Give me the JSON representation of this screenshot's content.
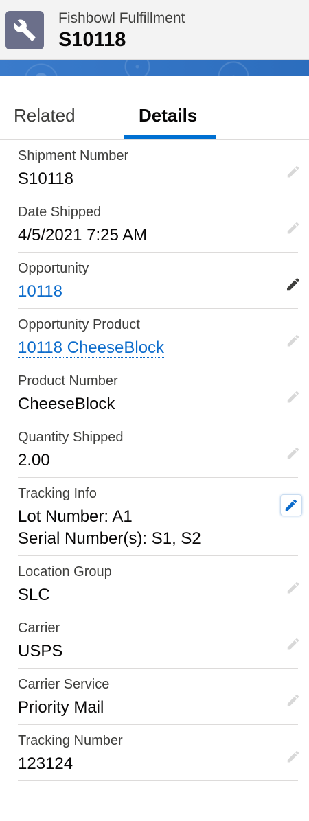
{
  "header": {
    "object_type": "Fishbowl Fulfillment",
    "record_name": "S10118",
    "icon": "wrench-icon"
  },
  "tabs": [
    {
      "label": "Related",
      "active": false
    },
    {
      "label": "Details",
      "active": true
    }
  ],
  "fields": [
    {
      "label": "Shipment Number",
      "value": "S10118"
    },
    {
      "label": "Date Shipped",
      "value": "4/5/2021 7:25 AM"
    },
    {
      "label": "Opportunity",
      "value": "10118"
    },
    {
      "label": "Opportunity Product",
      "value": "10118 CheeseBlock"
    },
    {
      "label": "Product Number",
      "value": "CheeseBlock"
    },
    {
      "label": "Quantity Shipped",
      "value": "2.00"
    },
    {
      "label": "Tracking Info",
      "value_line1": "Lot Number: A1",
      "value_line2": "Serial Number(s): S1, S2"
    },
    {
      "label": "Location Group",
      "value": "SLC"
    },
    {
      "label": "Carrier",
      "value": "USPS"
    },
    {
      "label": "Carrier Service",
      "value": "Priority Mail"
    },
    {
      "label": "Tracking Number",
      "value": "123124"
    }
  ],
  "colors": {
    "accent": "#0070d2",
    "link": "#0b6bcb",
    "icon_bg": "#6b6f8a"
  }
}
